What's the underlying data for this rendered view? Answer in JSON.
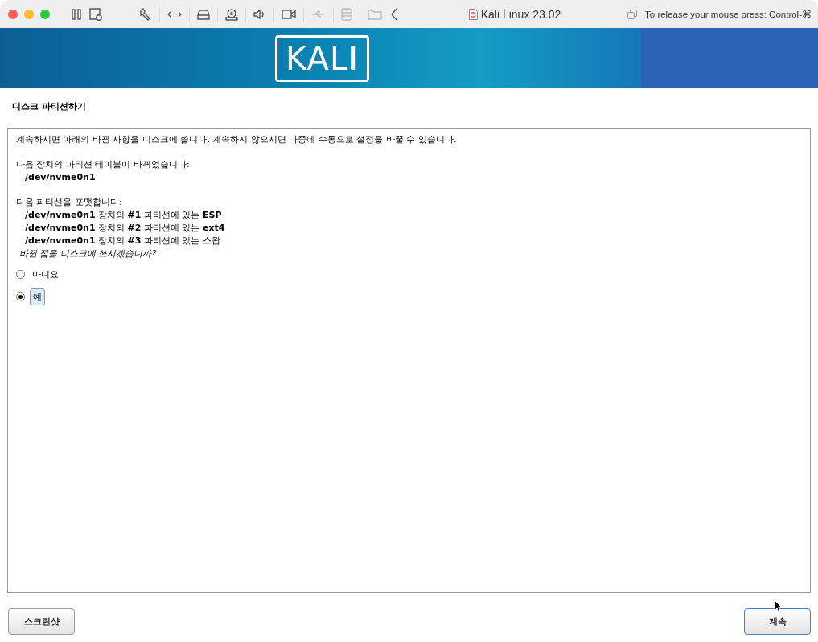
{
  "window": {
    "title": "Kali Linux 23.02",
    "release_hint": "To release your mouse press: Control-⌘",
    "toolbar": [
      {
        "kind": "pause",
        "disabled": false
      },
      {
        "kind": "snapshot",
        "disabled": false
      },
      {
        "kind": "wrench",
        "disabled": false
      },
      {
        "kind": "network",
        "disabled": false
      },
      {
        "kind": "disk",
        "disabled": false
      },
      {
        "kind": "optical",
        "disabled": false
      },
      {
        "kind": "sound",
        "disabled": false
      },
      {
        "kind": "camera",
        "disabled": false
      },
      {
        "kind": "usb",
        "disabled": true
      },
      {
        "kind": "storage",
        "disabled": true
      },
      {
        "kind": "folder",
        "disabled": true
      },
      {
        "kind": "back",
        "disabled": false
      }
    ]
  },
  "banner": {
    "logo": "KALI"
  },
  "page_title": "디스크 파티션하기",
  "intro": "계속하시면 아래의 바뀐 사항을 디스크에 씁니다. 계속하지 않으시면 나중에 수동으로 설정을 바꿀 수 있습니다.",
  "sections": [
    {
      "heading": "다음 장치의 파티션 테이블이 바뀌었습니다:",
      "items": [
        "**/dev/nvme0n1**"
      ]
    },
    {
      "heading": "다음 파티션을 포맷합니다:",
      "items": [
        "**/dev/nvme0n1** 장치의 **#1** 파티션에 있는 **ESP**",
        "**/dev/nvme0n1** 장치의 **#2** 파티션에 있는 **ext4**",
        "**/dev/nvme0n1** 장치의 **#3** 파티션에 있는 스왑"
      ]
    }
  ],
  "question": "바뀐 점을 디스크에 쓰시겠습니까?",
  "options": [
    {
      "label": "아니요",
      "selected": false
    },
    {
      "label": "예",
      "selected": true
    }
  ],
  "buttons": {
    "screenshot": "스크린샷",
    "continue": "계속"
  }
}
